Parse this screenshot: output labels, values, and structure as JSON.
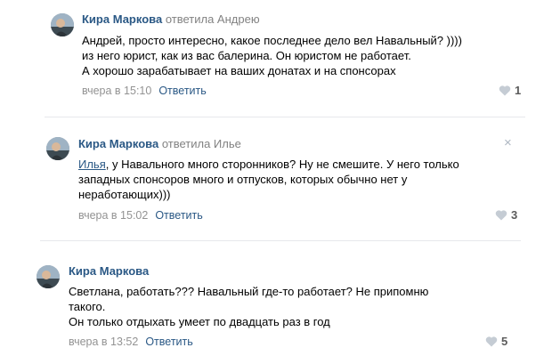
{
  "comments": [
    {
      "author": "Кира Маркова",
      "replied_to": "ответила Андрею",
      "lines": [
        "Андрей, просто интересно, какое последнее дело вел Навальный? ))))",
        "из него юрист, как из вас балерина. Он юристом не работает.",
        "А хорошо зарабатывает на ваших донатах и на спонсорах"
      ],
      "time": "вчера в 15:10",
      "reply_label": "Ответить",
      "likes": "1"
    },
    {
      "author": "Кира Маркова",
      "replied_to": "ответила Илье",
      "mention": "Илья",
      "line1_rest": ", у Навального много сторонников? Ну не смешите. У него только",
      "lines": [
        "западных спонсоров много и отпусков, которых обычно нет у",
        "неработающих)))"
      ],
      "time": "вчера в 15:02",
      "reply_label": "Ответить",
      "likes": "3",
      "close_icon": "×"
    },
    {
      "author": "Кира Маркова",
      "lines": [
        "Светлана, работать??? Навальный где-то работает? Не припомню",
        "такого.",
        "Он только отдыхать умеет по двадцать раз в год"
      ],
      "time": "вчера в 13:52",
      "reply_label": "Ответить",
      "likes": "5"
    }
  ],
  "icons": {
    "like": "heart-icon",
    "close": "close-icon",
    "avatar": "avatar"
  },
  "colors": {
    "link": "#2a5885",
    "meta": "#939393",
    "separator": "#e7e8ec"
  }
}
